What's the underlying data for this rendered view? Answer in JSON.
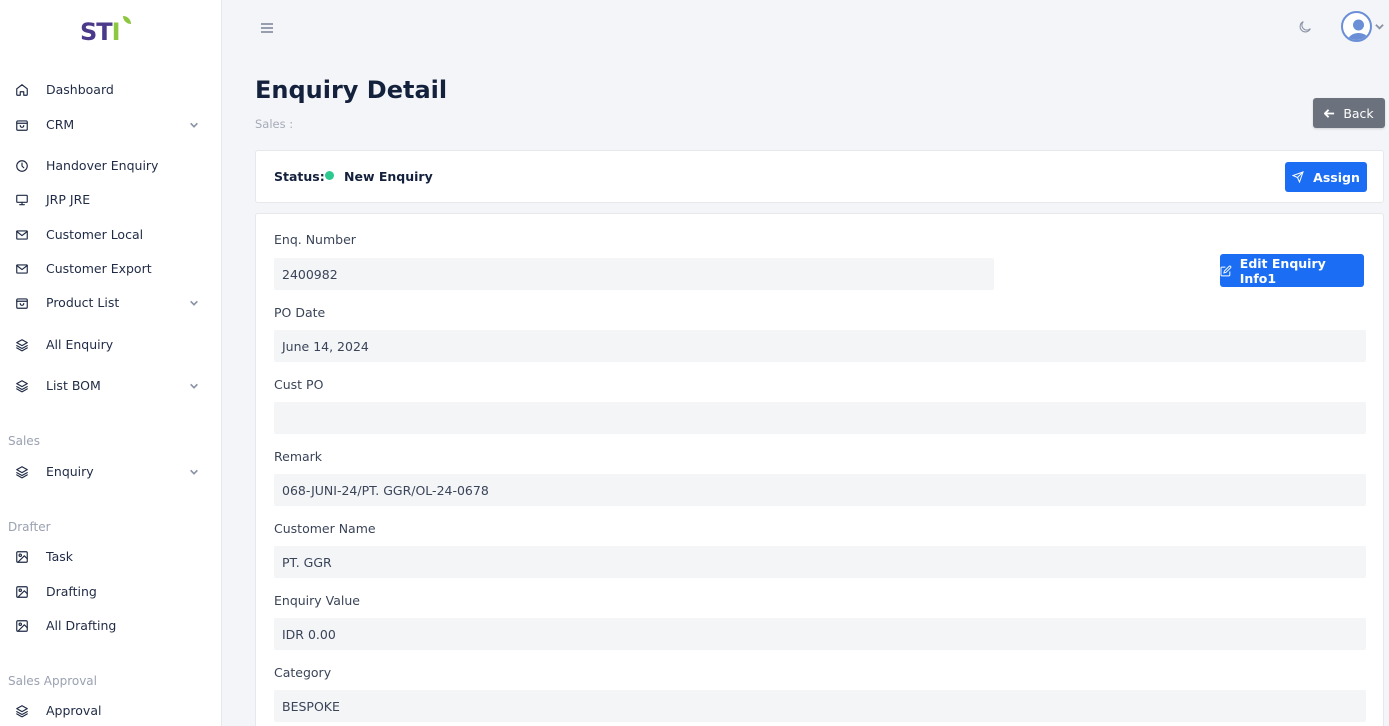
{
  "logo": {
    "text": "STI"
  },
  "sidebar": {
    "items": [
      {
        "label": "Dashboard",
        "icon": "home-icon"
      },
      {
        "label": "CRM",
        "icon": "bag-icon",
        "has_children": true
      },
      {
        "label": "Handover Enquiry",
        "icon": "clock-icon"
      },
      {
        "label": "JRP JRE",
        "icon": "monitor-icon"
      },
      {
        "label": "Customer Local",
        "icon": "mail-icon"
      },
      {
        "label": "Customer Export",
        "icon": "mail-icon"
      },
      {
        "label": "Product List",
        "icon": "bag-icon",
        "has_children": true
      },
      {
        "label": "All Enquiry",
        "icon": "layers-icon"
      },
      {
        "label": "List BOM",
        "icon": "layers-icon",
        "has_children": true
      }
    ],
    "sections": {
      "sales": {
        "title": "Sales",
        "items": [
          {
            "label": "Enquiry",
            "icon": "layers-icon",
            "has_children": true
          }
        ]
      },
      "drafter": {
        "title": "Drafter",
        "items": [
          {
            "label": "Task",
            "icon": "image-icon"
          },
          {
            "label": "Drafting",
            "icon": "image-icon"
          },
          {
            "label": "All Drafting",
            "icon": "image-icon"
          }
        ]
      },
      "sales_approval": {
        "title": "Sales Approval",
        "items": [
          {
            "label": "Approval",
            "icon": "layers-icon"
          }
        ]
      }
    }
  },
  "header": {
    "title": "Enquiry Detail",
    "breadcrumb": "Sales :",
    "back_label": "Back"
  },
  "status": {
    "label": "Status:",
    "value": "New Enquiry",
    "color": "#2ec98f",
    "assign_label": "Assign"
  },
  "details": {
    "edit_label": "Edit Enquiry Info1",
    "fields": [
      {
        "label": "Enq. Number",
        "value": "2400982"
      },
      {
        "label": "PO Date",
        "value": "June 14, 2024"
      },
      {
        "label": "Cust PO",
        "value": ""
      },
      {
        "label": "Remark",
        "value": "068-JUNI-24/PT. GGR/OL-24-0678"
      },
      {
        "label": "Customer Name",
        "value": "PT. GGR"
      },
      {
        "label": "Enquiry Value",
        "value": "IDR 0.00"
      },
      {
        "label": "Category",
        "value": "BESPOKE"
      }
    ]
  },
  "colors": {
    "primary": "#1b6ef3",
    "back": "#6c727d",
    "sidebar_bg": "#ffffff",
    "page_bg": "#f4f5f8"
  }
}
